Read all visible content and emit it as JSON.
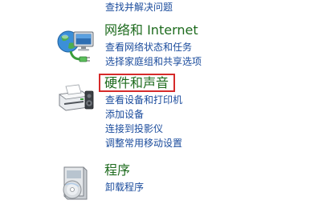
{
  "top_link": "查找并解决问题",
  "categories": [
    {
      "title": "网络和 Internet",
      "icon": "network-globe-icon",
      "links": [
        "查看网络状态和任务",
        "选择家庭组和共享选项"
      ]
    },
    {
      "title": "硬件和声音",
      "icon": "printer-speaker-icon",
      "links": [
        "查看设备和打印机",
        "添加设备",
        "连接到投影仪",
        "调整常用移动设置"
      ]
    },
    {
      "title": "程序",
      "icon": "programs-disc-icon",
      "links": [
        "卸载程序"
      ]
    }
  ],
  "colors": {
    "title": "#1e6b1e",
    "link": "#1a4b9c",
    "highlight": "#d62a2a"
  }
}
